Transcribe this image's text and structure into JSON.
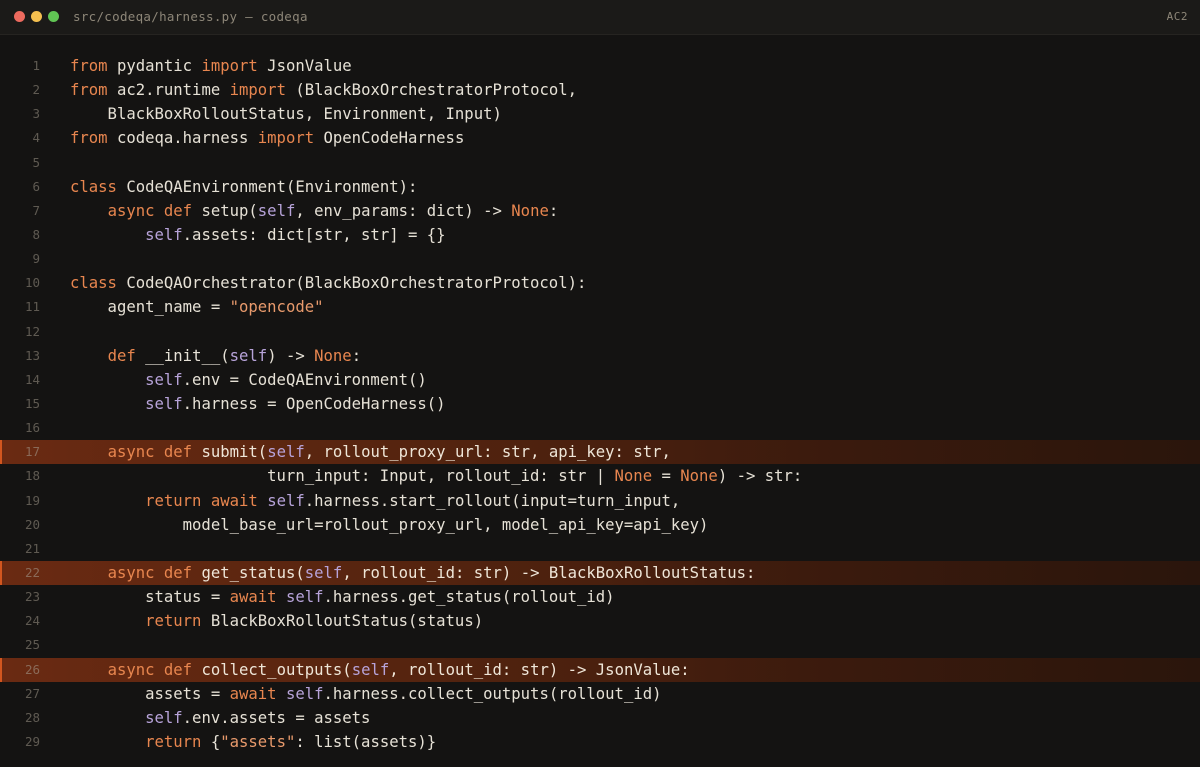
{
  "window": {
    "title": "src/codeqa/harness.py — codeqa",
    "badge": "AC2",
    "colors": {
      "close": "#ec6a5e",
      "minimize": "#f4bf4f",
      "maximize": "#61c554",
      "highlight": "#6a2a12",
      "keyword": "#e8864f",
      "self": "#b7a3d9",
      "string": "#e89a6c"
    }
  },
  "editor": {
    "highlighted_lines": [
      17,
      22,
      26
    ],
    "lines": [
      {
        "n": "1",
        "tokens": [
          [
            "kw",
            "from"
          ],
          [
            "pl",
            " pydantic "
          ],
          [
            "kw",
            "import"
          ],
          [
            "pl",
            " JsonValue"
          ]
        ]
      },
      {
        "n": "2",
        "tokens": [
          [
            "kw",
            "from"
          ],
          [
            "pl",
            " ac2.runtime "
          ],
          [
            "kw",
            "import"
          ],
          [
            "pl",
            " (BlackBoxOrchestratorProtocol,"
          ]
        ]
      },
      {
        "n": "3",
        "tokens": [
          [
            "pl",
            "    BlackBoxRolloutStatus, Environment, Input)"
          ]
        ]
      },
      {
        "n": "4",
        "tokens": [
          [
            "kw",
            "from"
          ],
          [
            "pl",
            " codeqa.harness "
          ],
          [
            "kw",
            "import"
          ],
          [
            "pl",
            " OpenCodeHarness"
          ]
        ]
      },
      {
        "n": "5",
        "tokens": []
      },
      {
        "n": "6",
        "tokens": [
          [
            "kw",
            "class"
          ],
          [
            "pl",
            " CodeQAEnvironment(Environment):"
          ]
        ]
      },
      {
        "n": "7",
        "tokens": [
          [
            "pl",
            "    "
          ],
          [
            "kw",
            "async"
          ],
          [
            "pl",
            " "
          ],
          [
            "kw",
            "def"
          ],
          [
            "pl",
            " setup("
          ],
          [
            "self",
            "self"
          ],
          [
            "pl",
            ", env_params: dict) -> "
          ],
          [
            "kw",
            "None"
          ],
          [
            "pl",
            ":"
          ]
        ]
      },
      {
        "n": "8",
        "tokens": [
          [
            "pl",
            "        "
          ],
          [
            "self",
            "self"
          ],
          [
            "pl",
            ".assets: dict[str, str] = {}"
          ]
        ]
      },
      {
        "n": "9",
        "tokens": []
      },
      {
        "n": "10",
        "tokens": [
          [
            "kw",
            "class"
          ],
          [
            "pl",
            " CodeQAOrchestrator(BlackBoxOrchestratorProtocol):"
          ]
        ]
      },
      {
        "n": "11",
        "tokens": [
          [
            "pl",
            "    agent_name = "
          ],
          [
            "str",
            "\"opencode\""
          ]
        ]
      },
      {
        "n": "12",
        "tokens": []
      },
      {
        "n": "13",
        "tokens": [
          [
            "pl",
            "    "
          ],
          [
            "kw",
            "def"
          ],
          [
            "pl",
            " __init__("
          ],
          [
            "self",
            "self"
          ],
          [
            "pl",
            ") -> "
          ],
          [
            "kw",
            "None"
          ],
          [
            "pl",
            ":"
          ]
        ]
      },
      {
        "n": "14",
        "tokens": [
          [
            "pl",
            "        "
          ],
          [
            "self",
            "self"
          ],
          [
            "pl",
            ".env = CodeQAEnvironment()"
          ]
        ]
      },
      {
        "n": "15",
        "tokens": [
          [
            "pl",
            "        "
          ],
          [
            "self",
            "self"
          ],
          [
            "pl",
            ".harness = OpenCodeHarness()"
          ]
        ]
      },
      {
        "n": "16",
        "tokens": []
      },
      {
        "n": "17",
        "tokens": [
          [
            "pl",
            "    "
          ],
          [
            "kw",
            "async"
          ],
          [
            "pl",
            " "
          ],
          [
            "kw",
            "def"
          ],
          [
            "pl",
            " submit("
          ],
          [
            "self",
            "self"
          ],
          [
            "pl",
            ", rollout_proxy_url: str, api_key: str,"
          ]
        ]
      },
      {
        "n": "18",
        "tokens": [
          [
            "pl",
            "                     turn_input: Input, rollout_id: str | "
          ],
          [
            "kw",
            "None"
          ],
          [
            "pl",
            " = "
          ],
          [
            "kw",
            "None"
          ],
          [
            "pl",
            ") -> str:"
          ]
        ]
      },
      {
        "n": "19",
        "tokens": [
          [
            "pl",
            "        "
          ],
          [
            "kw",
            "return"
          ],
          [
            "pl",
            " "
          ],
          [
            "kw",
            "await"
          ],
          [
            "pl",
            " "
          ],
          [
            "self",
            "self"
          ],
          [
            "pl",
            ".harness.start_rollout(input=turn_input,"
          ]
        ]
      },
      {
        "n": "20",
        "tokens": [
          [
            "pl",
            "            model_base_url=rollout_proxy_url, model_api_key=api_key)"
          ]
        ]
      },
      {
        "n": "21",
        "tokens": []
      },
      {
        "n": "22",
        "tokens": [
          [
            "pl",
            "    "
          ],
          [
            "kw",
            "async"
          ],
          [
            "pl",
            " "
          ],
          [
            "kw",
            "def"
          ],
          [
            "pl",
            " get_status("
          ],
          [
            "self",
            "self"
          ],
          [
            "pl",
            ", rollout_id: str) -> BlackBoxRolloutStatus:"
          ]
        ]
      },
      {
        "n": "23",
        "tokens": [
          [
            "pl",
            "        status = "
          ],
          [
            "kw",
            "await"
          ],
          [
            "pl",
            " "
          ],
          [
            "self",
            "self"
          ],
          [
            "pl",
            ".harness.get_status(rollout_id)"
          ]
        ]
      },
      {
        "n": "24",
        "tokens": [
          [
            "pl",
            "        "
          ],
          [
            "kw",
            "return"
          ],
          [
            "pl",
            " BlackBoxRolloutStatus(status)"
          ]
        ]
      },
      {
        "n": "25",
        "tokens": []
      },
      {
        "n": "26",
        "tokens": [
          [
            "pl",
            "    "
          ],
          [
            "kw",
            "async"
          ],
          [
            "pl",
            " "
          ],
          [
            "kw",
            "def"
          ],
          [
            "pl",
            " collect_outputs("
          ],
          [
            "self",
            "self"
          ],
          [
            "pl",
            ", rollout_id: str) -> JsonValue:"
          ]
        ]
      },
      {
        "n": "27",
        "tokens": [
          [
            "pl",
            "        assets = "
          ],
          [
            "kw",
            "await"
          ],
          [
            "pl",
            " "
          ],
          [
            "self",
            "self"
          ],
          [
            "pl",
            ".harness.collect_outputs(rollout_id)"
          ]
        ]
      },
      {
        "n": "28",
        "tokens": [
          [
            "pl",
            "        "
          ],
          [
            "self",
            "self"
          ],
          [
            "pl",
            ".env.assets = assets"
          ]
        ]
      },
      {
        "n": "29",
        "tokens": [
          [
            "pl",
            "        "
          ],
          [
            "kw",
            "return"
          ],
          [
            "pl",
            " {"
          ],
          [
            "str",
            "\"assets\""
          ],
          [
            "pl",
            ": list(assets)}"
          ]
        ]
      }
    ]
  }
}
